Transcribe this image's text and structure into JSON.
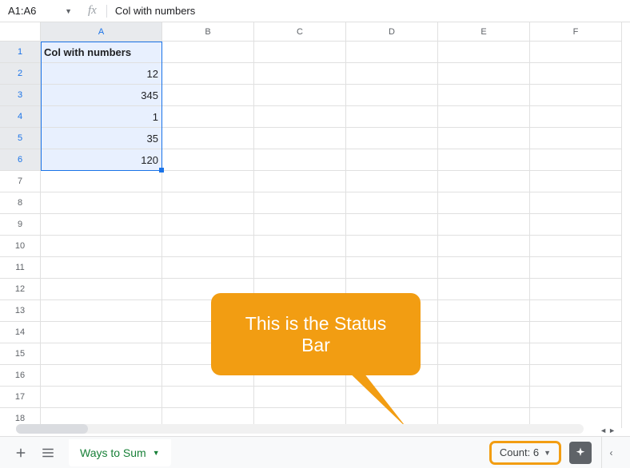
{
  "formula_bar": {
    "name_box": "A1:A6",
    "fx": "fx",
    "value": "Col with numbers"
  },
  "columns": [
    "A",
    "B",
    "C",
    "D",
    "E",
    "F"
  ],
  "rows": [
    "1",
    "2",
    "3",
    "4",
    "5",
    "6",
    "7",
    "8",
    "9",
    "10",
    "11",
    "12",
    "13",
    "14",
    "15",
    "16",
    "17",
    "18"
  ],
  "cells": {
    "a": [
      "Col with numbers",
      "12",
      "345",
      "1",
      "35",
      "120"
    ]
  },
  "callout": {
    "text": "This is the Status Bar"
  },
  "bottom": {
    "sheet_tab": "Ways to Sum",
    "count_label": "Count: 6"
  },
  "chart_data": {
    "type": "table",
    "title": "Col with numbers",
    "categories": [
      "row2",
      "row3",
      "row4",
      "row5",
      "row6"
    ],
    "values": [
      12,
      345,
      1,
      35,
      120
    ]
  }
}
